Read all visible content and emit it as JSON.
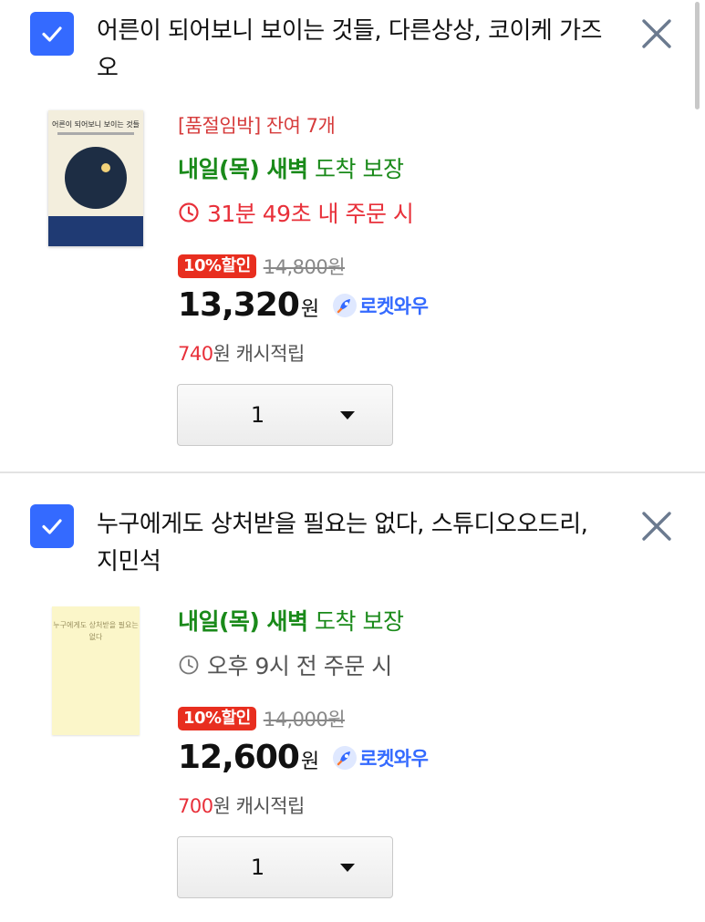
{
  "cart": {
    "items": [
      {
        "title": "어른이 되어보니 보이는 것들, 다른상상, 코이케 가즈오",
        "checked": true,
        "cover_title": "어른이 되어보니 보이는 것들",
        "stock_notice": "[품절임박] 잔여 7개",
        "delivery_bold": "내일(목) 새벽",
        "delivery_rest": " 도착 보장",
        "order_timer": "31분 49초 내 주문 시",
        "discount": "10%할인",
        "original_price": "14,800원",
        "price": "13,320",
        "currency": "원",
        "membership": "로켓와우",
        "cashback_amount": "740",
        "cashback_label": "원 캐시적립",
        "quantity": "1"
      },
      {
        "title": "누구에게도 상처받을 필요는 없다, 스튜디오오드리, 지민석",
        "checked": true,
        "cover_title": "누구에게도 상처받을 필요는 없다",
        "delivery_bold": "내일(목) 새벽",
        "delivery_rest": " 도착 보장",
        "order_timer": "오후 9시 전 주문 시",
        "discount": "10%할인",
        "original_price": "14,000원",
        "price": "12,600",
        "currency": "원",
        "membership": "로켓와우",
        "cashback_amount": "700",
        "cashback_label": "원 캐시적립",
        "quantity": "1"
      }
    ]
  },
  "icons": {
    "checkbox": "check-icon",
    "remove": "close-icon",
    "timer": "clock-icon",
    "membership": "rocket-icon"
  },
  "colors": {
    "accent": "#346aff",
    "delivery": "#1a8a1a",
    "alert": "#e8303a",
    "badge": "#e82e1f"
  }
}
